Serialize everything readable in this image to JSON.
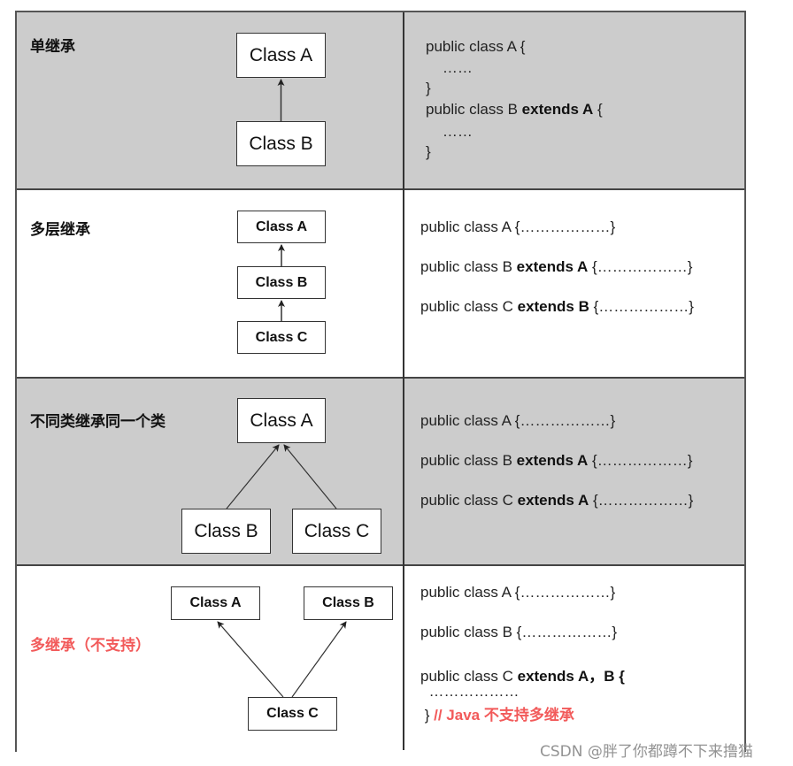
{
  "rows": [
    {
      "title": "单继承",
      "classes": [
        "Class A",
        "Class B"
      ],
      "code": [
        {
          "plain": "public class A {",
          "bold": "",
          "tail": ""
        },
        {
          "plain": "    ……",
          "bold": "",
          "tail": ""
        },
        {
          "plain": "}",
          "bold": "",
          "tail": ""
        },
        {
          "plain": "public class B ",
          "bold": "extends A",
          "tail": " {"
        },
        {
          "plain": "    ……",
          "bold": "",
          "tail": ""
        },
        {
          "plain": "}",
          "bold": "",
          "tail": ""
        }
      ]
    },
    {
      "title": "多层继承",
      "classes": [
        "Class A",
        "Class B",
        "Class C"
      ],
      "code": [
        {
          "plain": "public class A ",
          "bold": "",
          "tail": "{………………}"
        },
        {
          "plain": "public class B ",
          "bold": "extends A",
          "tail": " {………………}"
        },
        {
          "plain": "public class C ",
          "bold": "extends B",
          "tail": " {………………}"
        }
      ]
    },
    {
      "title": "不同类继承同一个类",
      "classes": [
        "Class A",
        "Class B",
        "Class C"
      ],
      "code": [
        {
          "plain": "public class A ",
          "bold": "",
          "tail": "{………………}"
        },
        {
          "plain": "public class B ",
          "bold": "extends A",
          "tail": " {………………}"
        },
        {
          "plain": "public class C ",
          "bold": "extends A",
          "tail": " {………………}"
        }
      ]
    },
    {
      "title": "多继承（不支持）",
      "classes": [
        "Class A",
        "Class B",
        "Class C"
      ],
      "code": [
        {
          "plain": "public class A ",
          "bold": "",
          "tail": "{………………}"
        },
        {
          "plain": "public class B ",
          "bold": "",
          "tail": "{………………}"
        },
        {
          "plain": "public class C ",
          "bold": "extends A，B {",
          "tail": ""
        },
        {
          "plain": "  ………………",
          "bold": "",
          "tail": ""
        },
        {
          "plain": " }",
          "bold": "",
          "tail": "",
          "comment": "// Java 不支持多继承"
        }
      ]
    }
  ],
  "colors": {
    "gray_row": "#cccccc",
    "white_row": "#ffffff",
    "warning_red": "#f25a5a",
    "border": "#444444"
  },
  "watermark": "CSDN @胖了你都蹲不下来撸猫"
}
